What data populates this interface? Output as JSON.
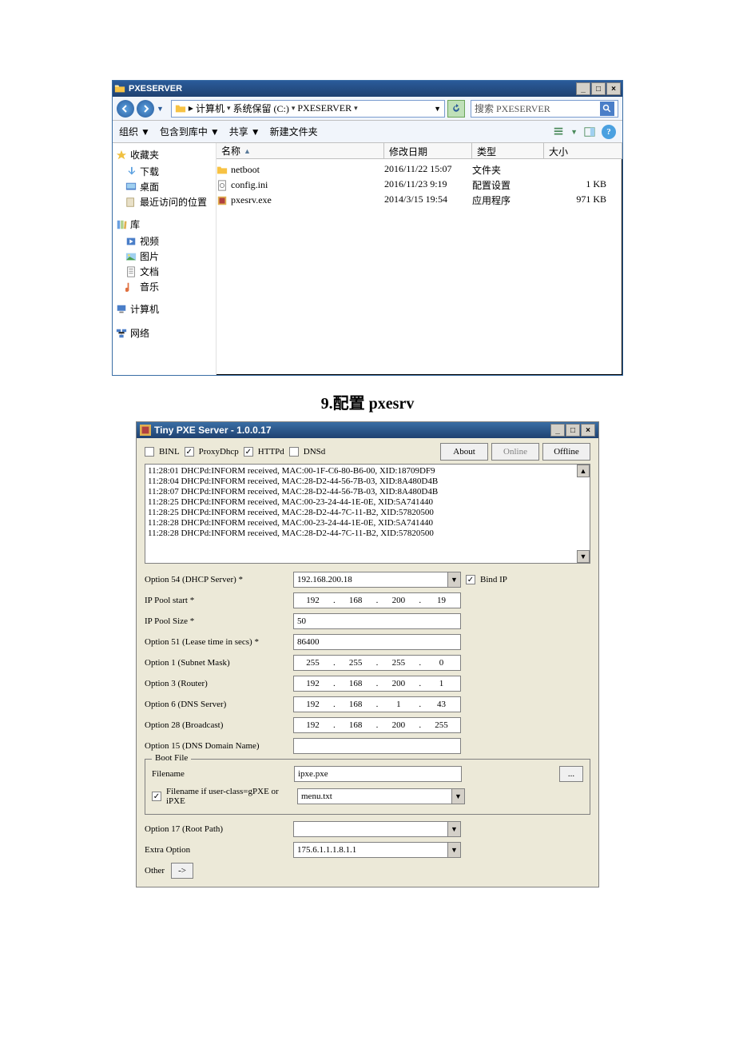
{
  "explorer": {
    "title": "PXESERVER",
    "winbtns": {
      "min": "_",
      "max": "□",
      "close": "×"
    },
    "breadcrumb": [
      "计算机",
      "系统保留 (C:)",
      "PXESERVER"
    ],
    "search_placeholder": "搜索 PXESERVER",
    "toolbar": {
      "organize": "组织 ▼",
      "include": "包含到库中 ▼",
      "share": "共享 ▼",
      "newfolder": "新建文件夹"
    },
    "sidebar": {
      "fav_title": "收藏夹",
      "favs": [
        "下载",
        "桌面",
        "最近访问的位置"
      ],
      "lib_title": "库",
      "libs": [
        "视频",
        "图片",
        "文档",
        "音乐"
      ],
      "computer": "计算机",
      "network": "网络"
    },
    "columns": {
      "name": "名称",
      "date": "修改日期",
      "type": "类型",
      "size": "大小"
    },
    "rows": [
      {
        "name": "netboot",
        "date": "2016/11/22 15:07",
        "type": "文件夹",
        "size": ""
      },
      {
        "name": "config.ini",
        "date": "2016/11/23 9:19",
        "type": "配置设置",
        "size": "1 KB"
      },
      {
        "name": "pxesrv.exe",
        "date": "2014/3/15 19:54",
        "type": "应用程序",
        "size": "971 KB"
      }
    ]
  },
  "section_title": "9.配置 pxesrv",
  "pxe": {
    "title": "Tiny PXE Server - 1.0.0.17",
    "winbtns": {
      "min": "_",
      "max": "□",
      "close": "×"
    },
    "checks": {
      "binl": {
        "label": "BINL",
        "checked": false
      },
      "proxy": {
        "label": "ProxyDhcp",
        "checked": true
      },
      "httpd": {
        "label": "HTTPd",
        "checked": true
      },
      "dnsd": {
        "label": "DNSd",
        "checked": false
      }
    },
    "buttons": {
      "about": "About",
      "online": "Online",
      "offline": "Offline"
    },
    "log": [
      "11:28:01 DHCPd:INFORM received, MAC:00-1F-C6-80-B6-00, XID:18709DF9",
      "11:28:04 DHCPd:INFORM received, MAC:28-D2-44-56-7B-03, XID:8A480D4B",
      "11:28:07 DHCPd:INFORM received, MAC:28-D2-44-56-7B-03, XID:8A480D4B",
      "11:28:25 DHCPd:INFORM received, MAC:00-23-24-44-1E-0E, XID:5A741440",
      "11:28:25 DHCPd:INFORM received, MAC:28-D2-44-7C-11-B2, XID:57820500",
      "11:28:28 DHCPd:INFORM received, MAC:00-23-24-44-1E-0E, XID:5A741440",
      "11:28:28 DHCPd:INFORM received, MAC:28-D2-44-7C-11-B2, XID:57820500"
    ],
    "labels": {
      "opt54": "Option 54 (DHCP Server) *",
      "poolstart": "IP Pool start *",
      "poolsize": "IP Pool Size *",
      "opt51": "Option 51 (Lease time in secs) *",
      "opt1": "Option 1  (Subnet Mask)",
      "opt3": "Option 3  (Router)",
      "opt6": "Option 6  (DNS Server)",
      "opt28": "Option 28 (Broadcast)",
      "opt15": "Option 15 (DNS Domain Name)",
      "bootlegend": "Boot File",
      "filename": "Filename",
      "userclass": "Filename if user-class=gPXE or iPXE",
      "opt17": "Option 17 (Root Path)",
      "extra": "Extra Option",
      "other": "Other",
      "bindip": "Bind IP"
    },
    "values": {
      "dhcp_server": "192.168.200.18",
      "poolstart": [
        "192",
        "168",
        "200",
        "19"
      ],
      "poolsize": "50",
      "lease": "86400",
      "subnet": [
        "255",
        "255",
        "255",
        "0"
      ],
      "router": [
        "192",
        "168",
        "200",
        "1"
      ],
      "dns": [
        "192",
        "168",
        "1",
        "43"
      ],
      "broadcast": [
        "192",
        "168",
        "200",
        "255"
      ],
      "dnsname": "",
      "filename": "ipxe.pxe",
      "userclass_file": "menu.txt",
      "rootpath": "",
      "extra": "175.6.1.1.1.8.1.1",
      "bindip_checked": true,
      "userclass_checked": true,
      "browse": "...",
      "arrow": "->"
    }
  }
}
